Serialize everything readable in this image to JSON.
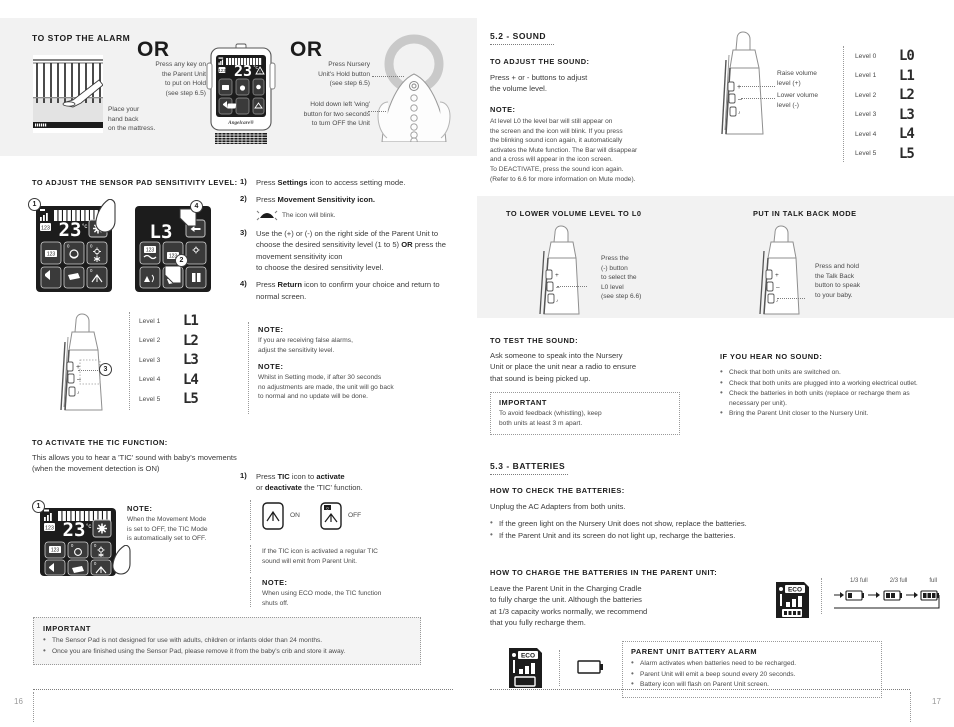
{
  "left_page": {
    "page_number": "16",
    "stop_alarm": {
      "heading": "TO STOP THE ALARM",
      "or_1": "OR",
      "or_2": "OR",
      "crib_caption": "Place your\nhand back\non the mattress.",
      "parent_caption": "Press any key on\nthe Parent Unit\nto put on Hold\n(see step 6.5)",
      "nursery_caption_1": "Press Nursery\nUnit's Hold button\n(see step 6.5)",
      "nursery_caption_2": "Hold down left 'wing'\nbutton for two seconds\nto turn OFF the Unit",
      "lcd_temp": "23",
      "lcd_unit": "°c",
      "brand": "Angelcare®"
    },
    "sensitivity": {
      "heading": "TO ADJUST THE SENSOR PAD SENSITIVITY LEVEL:",
      "lcd_temp": "23",
      "lcd_unit": "°c",
      "lcd_code": "L3",
      "callouts": [
        "1",
        "2",
        "3",
        "4"
      ],
      "steps": [
        {
          "num": "1)",
          "text_parts": [
            {
              "t": "Press ",
              "b": false
            },
            {
              "t": "Settings",
              "b": true
            },
            {
              "t": " icon to access setting mode.",
              "b": false
            }
          ]
        },
        {
          "num": "2)",
          "text_parts": [
            {
              "t": "Press ",
              "b": false
            },
            {
              "t": "Movement Sensitivity icon.",
              "b": true
            }
          ]
        },
        {
          "num": "3)",
          "text_parts": [
            {
              "t": "Use the (+) or (-) on the right side of the Parent Unit to choose the desired sensitivity level (1 to 5) ",
              "b": false
            },
            {
              "t": "OR",
              "b": true
            },
            {
              "t": " press the movement sensitivity icon to choose the desired sensitivity level.",
              "b": false
            }
          ]
        },
        {
          "num": "4)",
          "text_parts": [
            {
              "t": "Press ",
              "b": false
            },
            {
              "t": "Return",
              "b": true
            },
            {
              "t": " icon to confirm your choice and return to normal screen.",
              "b": false
            }
          ]
        }
      ],
      "blink_note": "The icon will blink.",
      "note_1_title": "NOTE:",
      "note_1_body": "If you are receiving false alarms,\nadjust the sensitivity level.",
      "note_2_title": "NOTE:",
      "note_2_body": "Whilst in Setting mode, if after 30 seconds\nno adjustments are made, the unit will go back\nto normal and no update will be done.",
      "levels": [
        {
          "label": "Level 1",
          "code": "L1"
        },
        {
          "label": "Level 2",
          "code": "L2"
        },
        {
          "label": "Level 3",
          "code": "L3"
        },
        {
          "label": "Level 4",
          "code": "L4"
        },
        {
          "label": "Level 5",
          "code": "L5"
        }
      ]
    },
    "tic": {
      "heading": "TO ACTIVATE THE TIC FUNCTION:",
      "intro": "This allows you to hear a 'TIC' sound with baby's movements\n(when the movement detection is ON)",
      "step_num": "1)",
      "step_parts": [
        {
          "t": "Press ",
          "b": false
        },
        {
          "t": "TIC",
          "b": true
        },
        {
          "t": " icon to ",
          "b": false
        },
        {
          "t": "activate",
          "b": true
        },
        {
          "t": " or ",
          "b": false
        },
        {
          "t": "deactivate",
          "b": true
        },
        {
          "t": " the 'TIC' function.",
          "b": false
        }
      ],
      "callout": "1",
      "lcd_temp": "23",
      "lcd_unit": "°c",
      "note_title": "NOTE:",
      "note_body": "When the Movement Mode\nis set to OFF, the TIC Mode\nis automatically set to OFF.",
      "icon_on_label": "ON",
      "icon_off_label": "OFF",
      "tic_info": "If the TIC icon is activated a regular TIC\nsound will emit from Parent Unit.",
      "note2_title": "NOTE:",
      "note2_body": "When using ECO mode, the TIC function\nshuts off."
    },
    "important": {
      "title": "IMPORTANT",
      "items": [
        "The Sensor Pad is not designed for use with adults, children or infants older than 24 months.",
        "Once you are finished using the Sensor Pad, please remove it from the baby's crib and store it away."
      ]
    }
  },
  "right_page": {
    "page_number": "17",
    "sound": {
      "section_title": "5.2 - SOUND",
      "adjust_heading": "TO ADJUST THE SOUND:",
      "adjust_body": "Press + or - buttons to adjust\nthe volume level.",
      "note_title": "NOTE:",
      "note_body": "At level L0 the level bar will still appear on\nthe screen and the icon will blink. If you press\nthe blinking sound icon again, it automatically\nactivates the Mute function. The Bar will disappear\nand a cross will appear in the icon screen.\nTo DEACTIVATE, press the sound icon again.\n(Refer to 6.6 for more information on Mute mode).",
      "raise_label": "Raise volume\nlevel (+)",
      "lower_label": "Lower volume\nlevel (-)",
      "levels": [
        {
          "label": "Level 0",
          "code": "L0"
        },
        {
          "label": "Level 1",
          "code": "L1"
        },
        {
          "label": "Level 2",
          "code": "L2"
        },
        {
          "label": "Level 3",
          "code": "L3"
        },
        {
          "label": "Level 4",
          "code": "L4"
        },
        {
          "label": "Level 5",
          "code": "L5"
        }
      ]
    },
    "lower_volume": {
      "heading": "TO LOWER VOLUME LEVEL TO L0",
      "caption": "Press the\n(-) button\nto select the\nL0 level\n(see step 6.6)"
    },
    "talk_back": {
      "heading": "PUT IN TALK BACK MODE",
      "caption": "Press and hold\nthe Talk Back\nbutton to speak\nto your baby."
    },
    "test_sound": {
      "heading": "TO TEST THE SOUND:",
      "body": "Ask someone to speak into the Nursery\nUnit or place the unit near a radio to ensure\nthat sound is being picked up.",
      "important_title": "IMPORTANT",
      "important_body": "To avoid feedback (whistling), keep\nboth units at least 3 m apart."
    },
    "no_sound": {
      "heading": "IF YOU HEAR NO SOUND:",
      "items": [
        "Check that both units are switched on.",
        "Check that both units are plugged into a working electrical outlet.",
        "Check the batteries in both units (replace or recharge them as necessary per unit).",
        "Bring the Parent Unit closer to the Nursery Unit."
      ]
    },
    "batteries": {
      "section_title": "5.3 - BATTERIES",
      "check_heading": "HOW TO CHECK THE BATTERIES:",
      "check_body": "Unplug the AC Adapters from both units.",
      "check_items": [
        "If the green light on the Nursery Unit does not show, replace the batteries.",
        "If the Parent Unit and its screen do not light up, recharge the batteries."
      ],
      "charge_heading": "HOW TO CHARGE THE BATTERIES IN THE PARENT UNIT:",
      "charge_body": "Leave the Parent Unit in the Charging Cradle\nto fully charge the unit. Although the batteries\nat 1/3 capacity works normally, we recommend\nthat you fully recharge them.",
      "eco_label": "ECO",
      "charge_steps": [
        "1/3 full",
        "2/3 full",
        "full"
      ],
      "alarm_title": "PARENT UNIT BATTERY ALARM",
      "alarm_items": [
        "Alarm activates when batteries need to be recharged.",
        "Parent Unit will emit a beep sound every 20 seconds.",
        "Battery icon will flash on Parent Unit screen."
      ]
    }
  },
  "colors": {
    "band": "#f2f2f2",
    "lcd": "#1c1c1c",
    "text": "#2b2b2b",
    "muted": "#9a9a9a"
  }
}
